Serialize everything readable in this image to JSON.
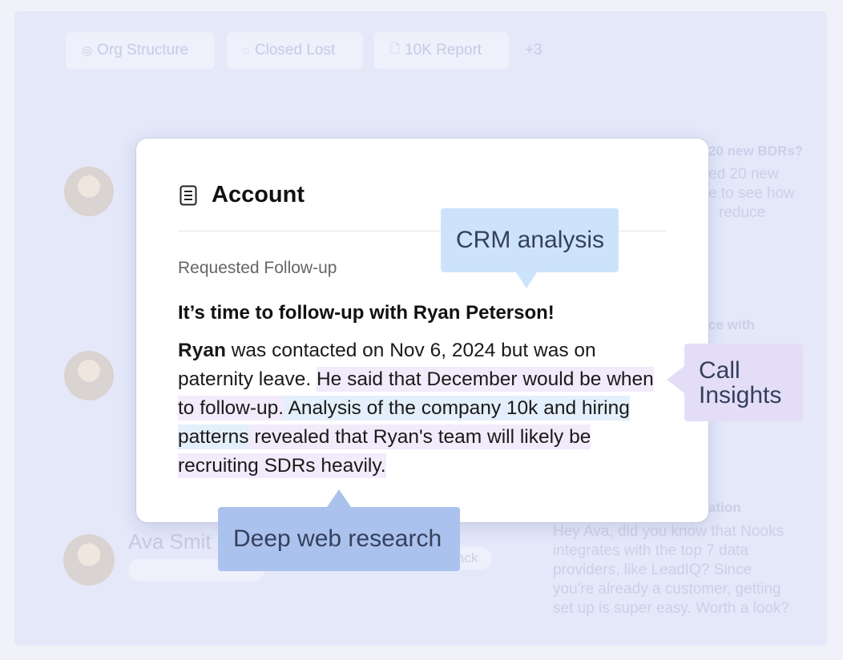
{
  "background": {
    "chips": [
      {
        "icon": "◎",
        "label": "Org Structure"
      },
      {
        "icon": "◌",
        "label": "Closed Lost"
      },
      {
        "icon": "🗋",
        "label": "10K Report"
      }
    ],
    "more_chips": "+3",
    "right_column": {
      "q1_title": "20 new BDRs?",
      "q1_lines": [
        "ed 20 new",
        "e to see how",
        "reduce"
      ],
      "q2_title": "ce with",
      "q3_title": "ation",
      "q3_lines": [
        "Hey Ava, did you know that Nooks",
        "integrates with the top 7 data",
        "providers, like LeadIQ? Since",
        "you're already a customer, getting",
        "set up is super easy. Worth a look?"
      ]
    },
    "contact_name": "Ava Smit",
    "pill_text": "ack"
  },
  "card": {
    "title": "Account",
    "section_label": "Requested Follow-up",
    "message_title": "It’s time to follow-up with Ryan Peterson!",
    "body": {
      "name": "Ryan",
      "plain": " was contacted on Nov 6, 2024 but was on paternity leave. ",
      "call_highlight": "He said that December would be when to follow-up.",
      "web_highlight": " Analysis of the company 10k and hiring patterns",
      "crm_highlight": " revealed that Ryan's team will likely be recruiting SDRs heavily."
    }
  },
  "callouts": {
    "crm": "CRM analysis",
    "call_line1": "Call",
    "call_line2": "Insights",
    "deep_web": "Deep web research"
  },
  "colors": {
    "crm": "#cde3fb",
    "call": "#e4ddf7",
    "deep_web": "#aac2ed"
  }
}
